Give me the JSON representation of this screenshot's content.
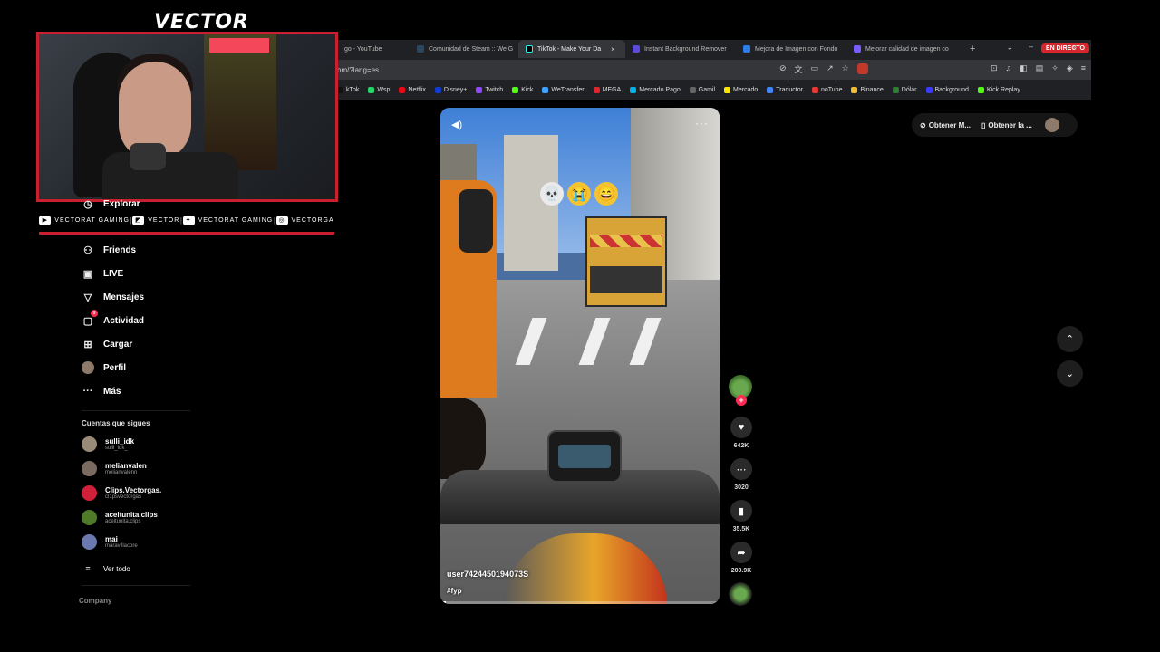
{
  "browser": {
    "tabs": [
      {
        "label": "go - YouTube",
        "color": "#ff0000"
      },
      {
        "label": "Comunidad de Steam :: We G",
        "color": "#1b2838"
      },
      {
        "label": "TikTok - Make Your Da",
        "color": "#111111",
        "active": true
      },
      {
        "label": "Instant Background Remover",
        "color": "#5b4bdb"
      },
      {
        "label": "Mejora de Imagen con Fondo",
        "color": "#2b7de9"
      },
      {
        "label": "Mejorar calidad de imagen co",
        "color": "#7a5cff"
      }
    ],
    "new_tab": "+",
    "live_badge": "EN DIRECTO",
    "url": "om/?lang=es",
    "bookmarks": [
      {
        "label": "kTok",
        "color": "#111111"
      },
      {
        "label": "Wsp",
        "color": "#25d366"
      },
      {
        "label": "Netflix",
        "color": "#e50914"
      },
      {
        "label": "Disney+",
        "color": "#113ccf"
      },
      {
        "label": "Twitch",
        "color": "#9146ff"
      },
      {
        "label": "Kick",
        "color": "#53fc18"
      },
      {
        "label": "WeTransfer",
        "color": "#409fff"
      },
      {
        "label": "MEGA",
        "color": "#d9272e"
      },
      {
        "label": "Mercado Pago",
        "color": "#00b1ea"
      },
      {
        "label": "Gamil",
        "color": "#666666"
      },
      {
        "label": "Mercado",
        "color": "#ffe600"
      },
      {
        "label": "Traductor",
        "color": "#4285f4"
      },
      {
        "label": "noTube",
        "color": "#e53935"
      },
      {
        "label": "Binance",
        "color": "#f3ba2f"
      },
      {
        "label": "Dólar",
        "color": "#2e7d32"
      },
      {
        "label": "Background",
        "color": "#3b3bff"
      },
      {
        "label": "Kick Replay",
        "color": "#53fc18"
      }
    ],
    "more": "»"
  },
  "overlay": {
    "logo": "VECTOR",
    "socials": [
      {
        "icon": "youtube-icon",
        "glyph": "▶",
        "label": "VECTORAT GAMING"
      },
      {
        "icon": "twitch-icon",
        "glyph": "◩",
        "label": "VECTOR"
      },
      {
        "icon": "twitter-icon",
        "glyph": "✦",
        "label": "VECTORAT GAMING"
      },
      {
        "icon": "instagram-icon",
        "glyph": "◎",
        "label": "VECTORGA"
      }
    ],
    "accent": "#c8202f"
  },
  "sidebar": {
    "items": [
      {
        "label": "Explorar",
        "icon": "compass-icon",
        "glyph": "◷"
      },
      {
        "label": "Friends",
        "icon": "friends-icon",
        "glyph": "⚇"
      },
      {
        "label": "LIVE",
        "icon": "live-icon",
        "glyph": "▣"
      },
      {
        "label": "Mensajes",
        "icon": "messages-icon",
        "glyph": "▽"
      },
      {
        "label": "Actividad",
        "icon": "activity-icon",
        "glyph": "▢",
        "badge": "9"
      },
      {
        "label": "Cargar",
        "icon": "upload-icon",
        "glyph": "⊞"
      },
      {
        "label": "Perfil",
        "icon": "profile-icon",
        "glyph": "●"
      },
      {
        "label": "Más",
        "icon": "more-icon",
        "glyph": "···"
      }
    ],
    "following_title": "Cuentas que sigues",
    "accounts": [
      {
        "name": "sulli_idk",
        "handle": "sulli_idk_",
        "color": "#9a8a78"
      },
      {
        "name": "melianvalen",
        "handle": "melianvalenn",
        "color": "#7a6a60"
      },
      {
        "name": "Clips.Vectorgas.",
        "handle": "cl1psvectorgas",
        "color": "#d0203a"
      },
      {
        "name": "aceitunita.clips",
        "handle": "aceitunita.clips",
        "color": "#4f7a2a"
      },
      {
        "name": "mai",
        "handle": "maravillacore",
        "color": "#6a7ab0"
      }
    ],
    "see_all": "Ver todo",
    "company": "Company"
  },
  "video": {
    "username": "user7424450194073S",
    "hashtag": "#fyp",
    "emojis": [
      "💀",
      "😭",
      "😄"
    ],
    "progress": 0.02
  },
  "actions": {
    "likes": "642K",
    "comments": "3020",
    "saves": "35.5K",
    "shares": "200.9K",
    "follow": "+"
  },
  "top_buttons": {
    "btn1": "Obtener M...",
    "btn2": "Obtener la ..."
  }
}
